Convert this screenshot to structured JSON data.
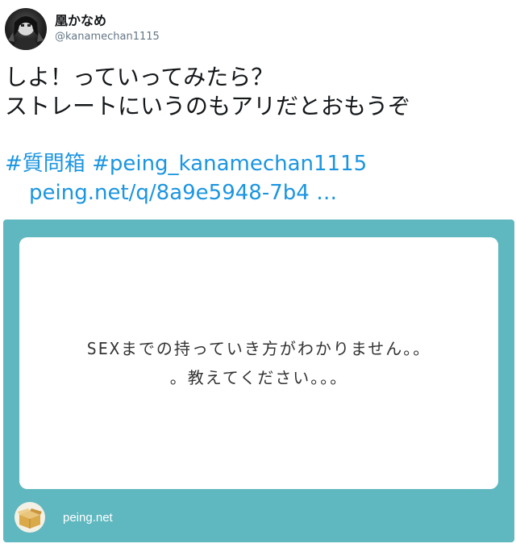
{
  "user": {
    "display_name": "凰かなめ",
    "handle": "@kanamechan1115",
    "avatar_icon": "avatar-icon"
  },
  "tweet": {
    "lines": [
      "しよ！っていってみたら？",
      "ストレートにいうのもアリだとおもうぞ"
    ],
    "hashtags": [
      "#質問箱",
      "#peing_kanamechan1115"
    ],
    "link": "peing.net/q/8a9e5948-7b4 …"
  },
  "card": {
    "question_lines": [
      "SEXまでの持っていき方がわかりません。。",
      "。教えてください。。。"
    ],
    "site_name": "peing.net",
    "site_icon": "box-icon",
    "colors": {
      "card_bg": "#5fb8bf",
      "link": "#1b95e0"
    }
  }
}
